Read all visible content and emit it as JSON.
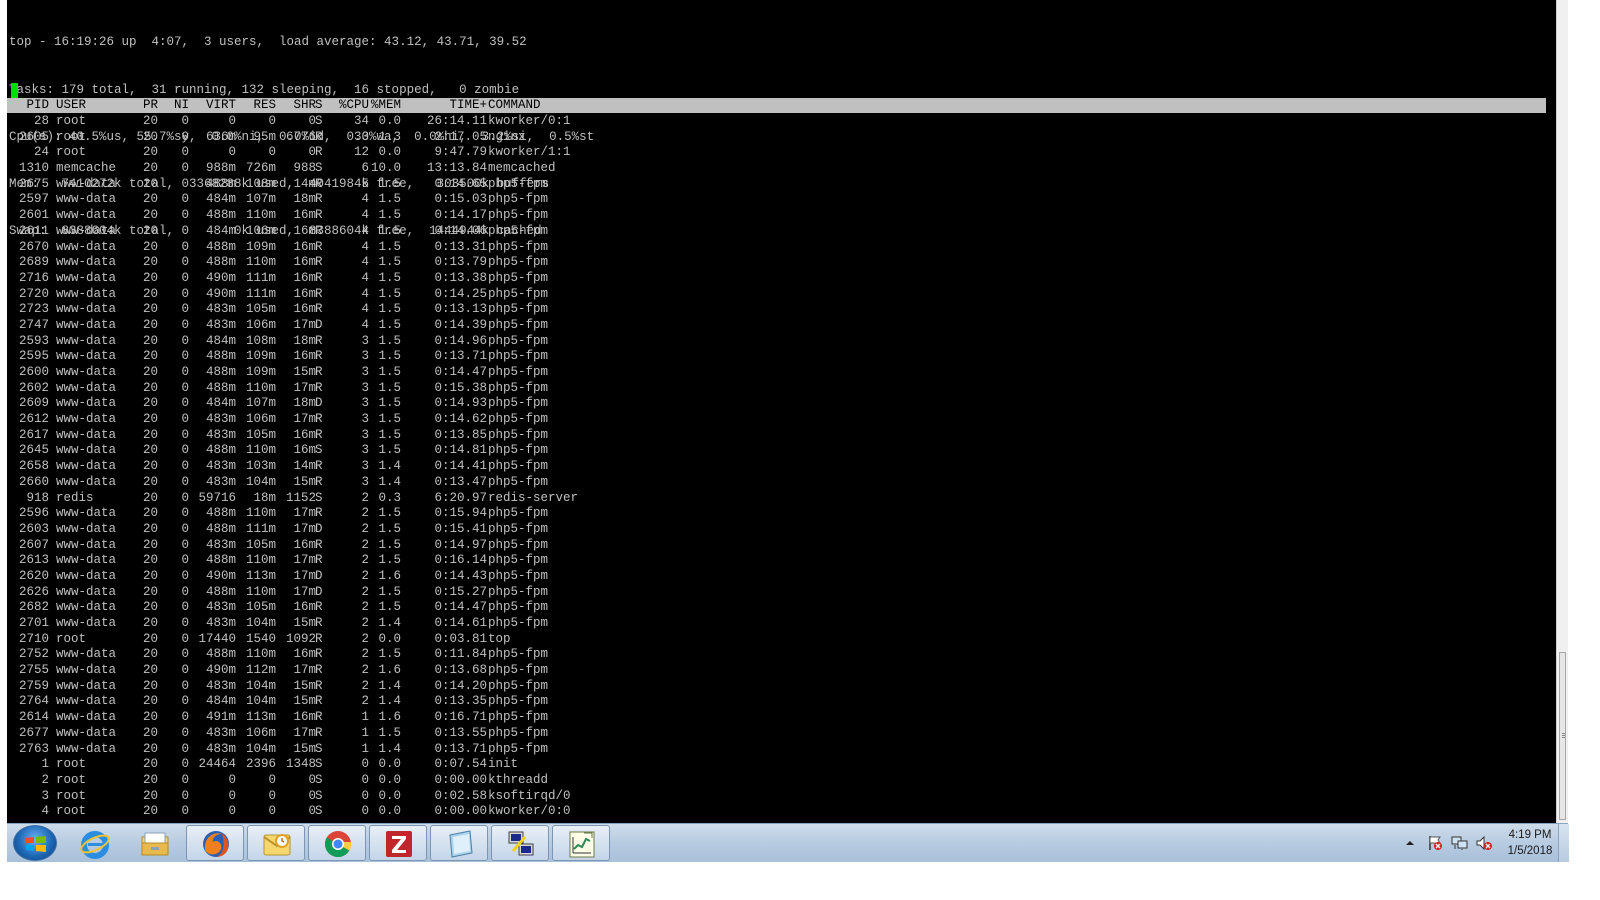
{
  "terminal": {
    "header_lines": [
      "top - 16:19:26 up  4:07,  3 users,  load average: 43.12, 43.71, 39.52",
      "Tasks: 179 total,  31 running, 132 sleeping,  16 stopped,   0 zombie",
      "Cpu(s): 40.5%us, 55.7%sy,  0.0%ni,  0.0%id,  0.0%wa,  0.0%hi,  3.2%si,  0.5%st",
      "Mem:   7410272k total,  3368288k used,  4041984k free,   303500k buffers",
      "Swap:  8388604k total,        0k used,  8388604k free,  1444944k cached"
    ],
    "columns": [
      "PID",
      "USER",
      "PR",
      "NI",
      "VIRT",
      "RES",
      "SHR",
      "S",
      "%CPU",
      "%MEM",
      "TIME+",
      "COMMAND"
    ],
    "processes": [
      [
        "28",
        "root",
        "20",
        "0",
        "0",
        "0",
        "0",
        "S",
        "34",
        "0.0",
        "26:14.11",
        "kworker/0:1"
      ],
      [
        "2605",
        "root",
        "20",
        "0",
        "636m",
        "95m",
        "6776",
        "R",
        "33",
        "1.3",
        "2:17.05",
        "nginx"
      ],
      [
        "24",
        "root",
        "20",
        "0",
        "0",
        "0",
        "0",
        "R",
        "12",
        "0.0",
        "9:47.79",
        "kworker/1:1"
      ],
      [
        "1310",
        "memcache",
        "20",
        "0",
        "988m",
        "726m",
        "988",
        "S",
        "6",
        "10.0",
        "13:13.84",
        "memcached"
      ],
      [
        "2675",
        "www-data",
        "20",
        "0",
        "488m",
        "108m",
        "14m",
        "R",
        "5",
        "1.5",
        "0:14.65",
        "php5-fpm"
      ],
      [
        "2597",
        "www-data",
        "20",
        "0",
        "484m",
        "107m",
        "18m",
        "R",
        "4",
        "1.5",
        "0:15.03",
        "php5-fpm"
      ],
      [
        "2601",
        "www-data",
        "20",
        "0",
        "488m",
        "110m",
        "16m",
        "R",
        "4",
        "1.5",
        "0:14.17",
        "php5-fpm"
      ],
      [
        "2611",
        "www-data",
        "20",
        "0",
        "484m",
        "106m",
        "16m",
        "R",
        "4",
        "1.5",
        "0:14.06",
        "php5-fpm"
      ],
      [
        "2670",
        "www-data",
        "20",
        "0",
        "488m",
        "109m",
        "16m",
        "R",
        "4",
        "1.5",
        "0:13.31",
        "php5-fpm"
      ],
      [
        "2689",
        "www-data",
        "20",
        "0",
        "488m",
        "110m",
        "16m",
        "R",
        "4",
        "1.5",
        "0:13.79",
        "php5-fpm"
      ],
      [
        "2716",
        "www-data",
        "20",
        "0",
        "490m",
        "111m",
        "16m",
        "R",
        "4",
        "1.5",
        "0:13.38",
        "php5-fpm"
      ],
      [
        "2720",
        "www-data",
        "20",
        "0",
        "490m",
        "111m",
        "16m",
        "R",
        "4",
        "1.5",
        "0:14.25",
        "php5-fpm"
      ],
      [
        "2723",
        "www-data",
        "20",
        "0",
        "483m",
        "105m",
        "16m",
        "R",
        "4",
        "1.5",
        "0:13.13",
        "php5-fpm"
      ],
      [
        "2747",
        "www-data",
        "20",
        "0",
        "483m",
        "106m",
        "17m",
        "D",
        "4",
        "1.5",
        "0:14.39",
        "php5-fpm"
      ],
      [
        "2593",
        "www-data",
        "20",
        "0",
        "484m",
        "108m",
        "18m",
        "R",
        "3",
        "1.5",
        "0:14.96",
        "php5-fpm"
      ],
      [
        "2595",
        "www-data",
        "20",
        "0",
        "488m",
        "109m",
        "16m",
        "R",
        "3",
        "1.5",
        "0:13.71",
        "php5-fpm"
      ],
      [
        "2600",
        "www-data",
        "20",
        "0",
        "488m",
        "109m",
        "15m",
        "R",
        "3",
        "1.5",
        "0:14.47",
        "php5-fpm"
      ],
      [
        "2602",
        "www-data",
        "20",
        "0",
        "488m",
        "110m",
        "17m",
        "R",
        "3",
        "1.5",
        "0:15.38",
        "php5-fpm"
      ],
      [
        "2609",
        "www-data",
        "20",
        "0",
        "484m",
        "107m",
        "18m",
        "D",
        "3",
        "1.5",
        "0:14.93",
        "php5-fpm"
      ],
      [
        "2612",
        "www-data",
        "20",
        "0",
        "483m",
        "106m",
        "17m",
        "R",
        "3",
        "1.5",
        "0:14.62",
        "php5-fpm"
      ],
      [
        "2617",
        "www-data",
        "20",
        "0",
        "483m",
        "105m",
        "16m",
        "R",
        "3",
        "1.5",
        "0:13.85",
        "php5-fpm"
      ],
      [
        "2645",
        "www-data",
        "20",
        "0",
        "488m",
        "110m",
        "16m",
        "S",
        "3",
        "1.5",
        "0:14.81",
        "php5-fpm"
      ],
      [
        "2658",
        "www-data",
        "20",
        "0",
        "483m",
        "103m",
        "14m",
        "R",
        "3",
        "1.4",
        "0:14.41",
        "php5-fpm"
      ],
      [
        "2660",
        "www-data",
        "20",
        "0",
        "483m",
        "104m",
        "15m",
        "R",
        "3",
        "1.4",
        "0:13.47",
        "php5-fpm"
      ],
      [
        "918",
        "redis",
        "20",
        "0",
        "59716",
        "18m",
        "1152",
        "S",
        "2",
        "0.3",
        "6:20.97",
        "redis-server"
      ],
      [
        "2596",
        "www-data",
        "20",
        "0",
        "488m",
        "110m",
        "17m",
        "R",
        "2",
        "1.5",
        "0:15.94",
        "php5-fpm"
      ],
      [
        "2603",
        "www-data",
        "20",
        "0",
        "488m",
        "111m",
        "17m",
        "D",
        "2",
        "1.5",
        "0:15.41",
        "php5-fpm"
      ],
      [
        "2607",
        "www-data",
        "20",
        "0",
        "483m",
        "105m",
        "16m",
        "R",
        "2",
        "1.5",
        "0:14.97",
        "php5-fpm"
      ],
      [
        "2613",
        "www-data",
        "20",
        "0",
        "488m",
        "110m",
        "17m",
        "R",
        "2",
        "1.5",
        "0:16.14",
        "php5-fpm"
      ],
      [
        "2620",
        "www-data",
        "20",
        "0",
        "490m",
        "113m",
        "17m",
        "D",
        "2",
        "1.6",
        "0:14.43",
        "php5-fpm"
      ],
      [
        "2626",
        "www-data",
        "20",
        "0",
        "488m",
        "110m",
        "17m",
        "D",
        "2",
        "1.5",
        "0:15.27",
        "php5-fpm"
      ],
      [
        "2682",
        "www-data",
        "20",
        "0",
        "483m",
        "105m",
        "16m",
        "R",
        "2",
        "1.5",
        "0:14.47",
        "php5-fpm"
      ],
      [
        "2701",
        "www-data",
        "20",
        "0",
        "483m",
        "104m",
        "15m",
        "R",
        "2",
        "1.4",
        "0:14.61",
        "php5-fpm"
      ],
      [
        "2710",
        "root",
        "20",
        "0",
        "17440",
        "1540",
        "1092",
        "R",
        "2",
        "0.0",
        "0:03.81",
        "top"
      ],
      [
        "2752",
        "www-data",
        "20",
        "0",
        "488m",
        "110m",
        "16m",
        "R",
        "2",
        "1.5",
        "0:11.84",
        "php5-fpm"
      ],
      [
        "2755",
        "www-data",
        "20",
        "0",
        "490m",
        "112m",
        "17m",
        "R",
        "2",
        "1.6",
        "0:13.68",
        "php5-fpm"
      ],
      [
        "2759",
        "www-data",
        "20",
        "0",
        "483m",
        "104m",
        "15m",
        "R",
        "2",
        "1.4",
        "0:14.20",
        "php5-fpm"
      ],
      [
        "2764",
        "www-data",
        "20",
        "0",
        "484m",
        "104m",
        "15m",
        "R",
        "2",
        "1.4",
        "0:13.35",
        "php5-fpm"
      ],
      [
        "2614",
        "www-data",
        "20",
        "0",
        "491m",
        "113m",
        "16m",
        "R",
        "1",
        "1.6",
        "0:16.71",
        "php5-fpm"
      ],
      [
        "2677",
        "www-data",
        "20",
        "0",
        "483m",
        "106m",
        "17m",
        "R",
        "1",
        "1.5",
        "0:13.55",
        "php5-fpm"
      ],
      [
        "2763",
        "www-data",
        "20",
        "0",
        "483m",
        "104m",
        "15m",
        "S",
        "1",
        "1.4",
        "0:13.71",
        "php5-fpm"
      ],
      [
        "1",
        "root",
        "20",
        "0",
        "24464",
        "2396",
        "1348",
        "S",
        "0",
        "0.0",
        "0:07.54",
        "init"
      ],
      [
        "2",
        "root",
        "20",
        "0",
        "0",
        "0",
        "0",
        "S",
        "0",
        "0.0",
        "0:00.00",
        "kthreadd"
      ],
      [
        "3",
        "root",
        "20",
        "0",
        "0",
        "0",
        "0",
        "S",
        "0",
        "0.0",
        "0:02.58",
        "ksoftirqd/0"
      ],
      [
        "4",
        "root",
        "20",
        "0",
        "0",
        "0",
        "0",
        "S",
        "0",
        "0.0",
        "0:00.00",
        "kworker/0:0"
      ]
    ],
    "colors": {
      "background": "#000000",
      "text": "#c0c0c0",
      "header_bar": "#c0c0c0",
      "cursor": "#00e000"
    }
  },
  "taskbar": {
    "start_icon": "windows-start-orb",
    "apps": [
      {
        "icon": "internet-explorer-icon"
      },
      {
        "icon": "file-explorer-icon"
      },
      {
        "icon": "firefox-icon"
      },
      {
        "icon": "outlook-icon"
      },
      {
        "icon": "chrome-icon"
      },
      {
        "icon": "filezilla-icon"
      },
      {
        "icon": "notepad-icon"
      },
      {
        "icon": "putty-icon"
      },
      {
        "icon": "chart-editor-icon"
      }
    ],
    "tray": {
      "icons": [
        "show-hidden-icons-arrow",
        "action-center-flag-icon",
        "network-icon",
        "volume-muted-icon"
      ],
      "clock": {
        "time": "4:19 PM",
        "date": "1/5/2018"
      }
    }
  }
}
